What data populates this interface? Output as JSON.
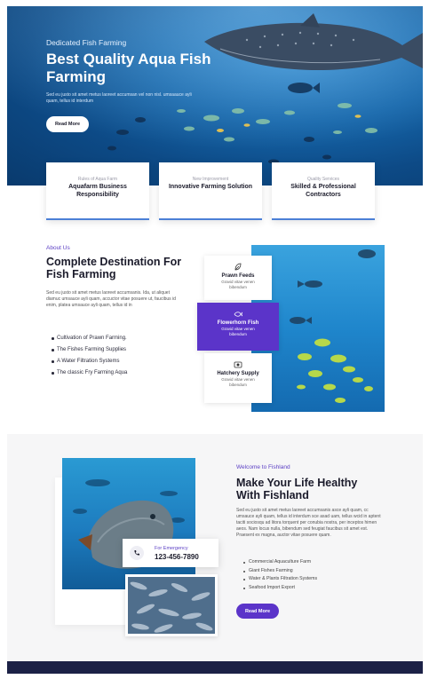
{
  "hero": {
    "eyebrow": "Dedicated Fish Farming",
    "title": "Best Quality Aqua Fish Farming",
    "text": "Sed eu justo sit amet metus laoreet accumsan vel non nisl. umsaauce ayli quam, tellus id interdum",
    "button": "Read More"
  },
  "features": [
    {
      "sub": "Rules of Aqua Farm",
      "title": "Aquafarm Business Responsibility"
    },
    {
      "sub": "New Improvement",
      "title": "Innovative Farming Solution"
    },
    {
      "sub": "Quality Services",
      "title": "Skilled & Professional Contractors"
    }
  ],
  "about": {
    "eyebrow": "About Us",
    "title": "Complete Destination For Fish Farming",
    "text": "Sed eu justo sit amet metus laoreet accumsanis. Ida, ut aliquet diamuc umsauce ayli quam, accuctor vitae posuere ut, faucibus id enim, platea umsauce ayli quam, tellus id in",
    "list": [
      "Cultivation of Prawn Farming.",
      "The Fishes Farming Supplies",
      "A Water Filtration Systems",
      "The classic Fry Farming Aqua"
    ],
    "services": [
      {
        "title": "Prawn Feeds",
        "desc": "Gravid vitae venen bibendum",
        "icon": "leaf-icon"
      },
      {
        "title": "Flowerhorn Fish",
        "desc": "Gravid vitae venen bibendum",
        "icon": "fish-icon"
      },
      {
        "title": "Hatchery Supply",
        "desc": "Gravid vitae venen bibendum",
        "icon": "hatchery-icon"
      }
    ]
  },
  "welcome": {
    "eyebrow": "Welcome to Fishland",
    "title": "Make Your Life Healthy With Fishland",
    "text": "Sed eu justo sit amet metus laoreet accumsanis asce ayli quam, cc umsauce ayli quam, tellus id interdum sce asad uam, tellus wcid in aptent taciti sociosqu ad litora torquent per conubia nostra, per inceptos himen aeos. Nam locus nulla, bibendum sed feugiat faucibus sit amet est. Praesent ex magna, auctor vitae posuere quam.",
    "list": [
      "Commercial Aquaculture Farm",
      "Giant Fishes Farming",
      "Water & Plants Filtration Systems",
      "Seafood Import Export"
    ],
    "button": "Read More",
    "emergency_label": "For Emergency",
    "emergency_phone": "123-456-7890"
  },
  "colors": {
    "accent": "#5b34c9",
    "footer": "#1c2146",
    "card_border": "#4b7fd6"
  }
}
